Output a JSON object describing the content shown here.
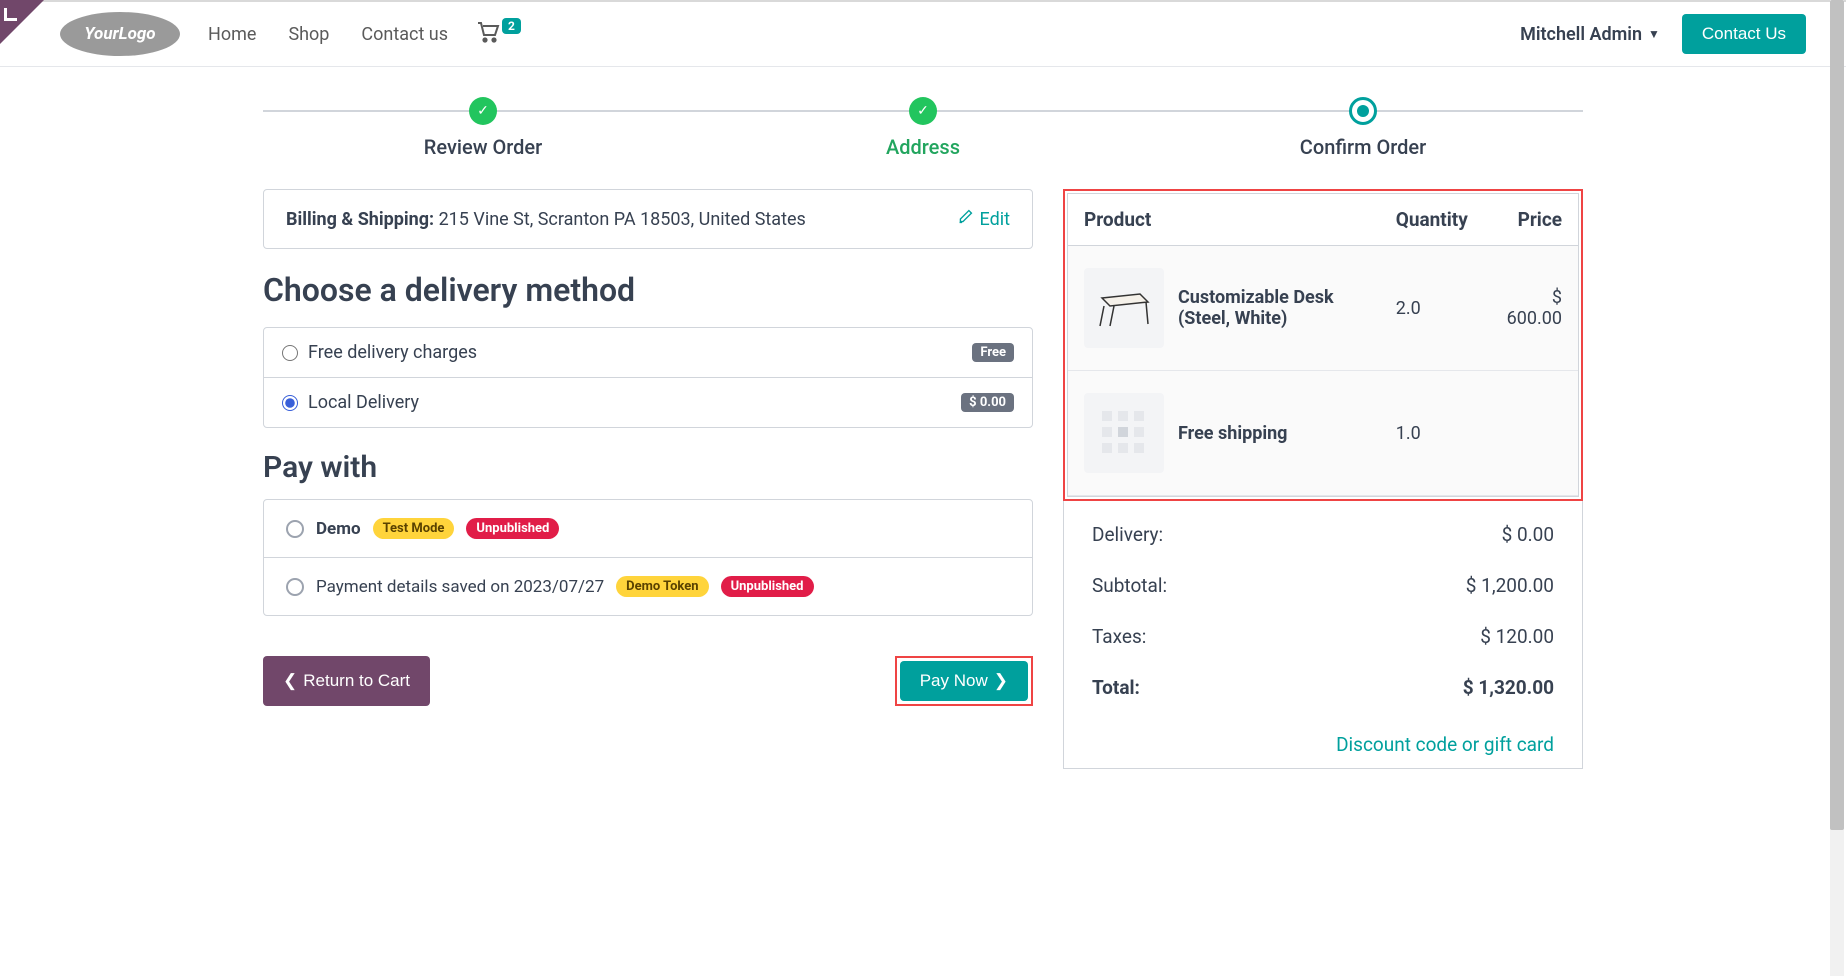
{
  "nav": {
    "home": "Home",
    "shop": "Shop",
    "contact": "Contact us",
    "cart_count": "2",
    "user": "Mitchell Admin",
    "contact_btn": "Contact Us"
  },
  "steps": {
    "s1": "Review Order",
    "s2": "Address",
    "s3": "Confirm Order"
  },
  "address": {
    "label": "Billing & Shipping:",
    "value": "215 Vine St, Scranton PA 18503, United States",
    "edit": "Edit"
  },
  "delivery": {
    "title": "Choose a delivery method",
    "opt1": {
      "label": "Free delivery charges",
      "badge": "Free"
    },
    "opt2": {
      "label": "Local Delivery",
      "badge": "$ 0.00"
    }
  },
  "payment": {
    "title": "Pay with",
    "p1": {
      "label": "Demo",
      "b1": "Test Mode",
      "b2": "Unpublished"
    },
    "p2": {
      "label": "Payment details saved on 2023/07/27",
      "b1": "Demo Token",
      "b2": "Unpublished"
    }
  },
  "actions": {
    "back": "Return to Cart",
    "pay": "Pay Now"
  },
  "summary": {
    "h_product": "Product",
    "h_qty": "Quantity",
    "h_price": "Price",
    "items": [
      {
        "name": "Customizable Desk (Steel, White)",
        "qty": "2.0",
        "price": "$ 600.00"
      },
      {
        "name": "Free shipping",
        "qty": "1.0",
        "price": ""
      }
    ],
    "delivery_l": "Delivery:",
    "delivery_v": "$ 0.00",
    "subtotal_l": "Subtotal:",
    "subtotal_v": "$ 1,200.00",
    "taxes_l": "Taxes:",
    "taxes_v": "$ 120.00",
    "total_l": "Total:",
    "total_v": "$ 1,320.00",
    "discount": "Discount code or gift card"
  }
}
